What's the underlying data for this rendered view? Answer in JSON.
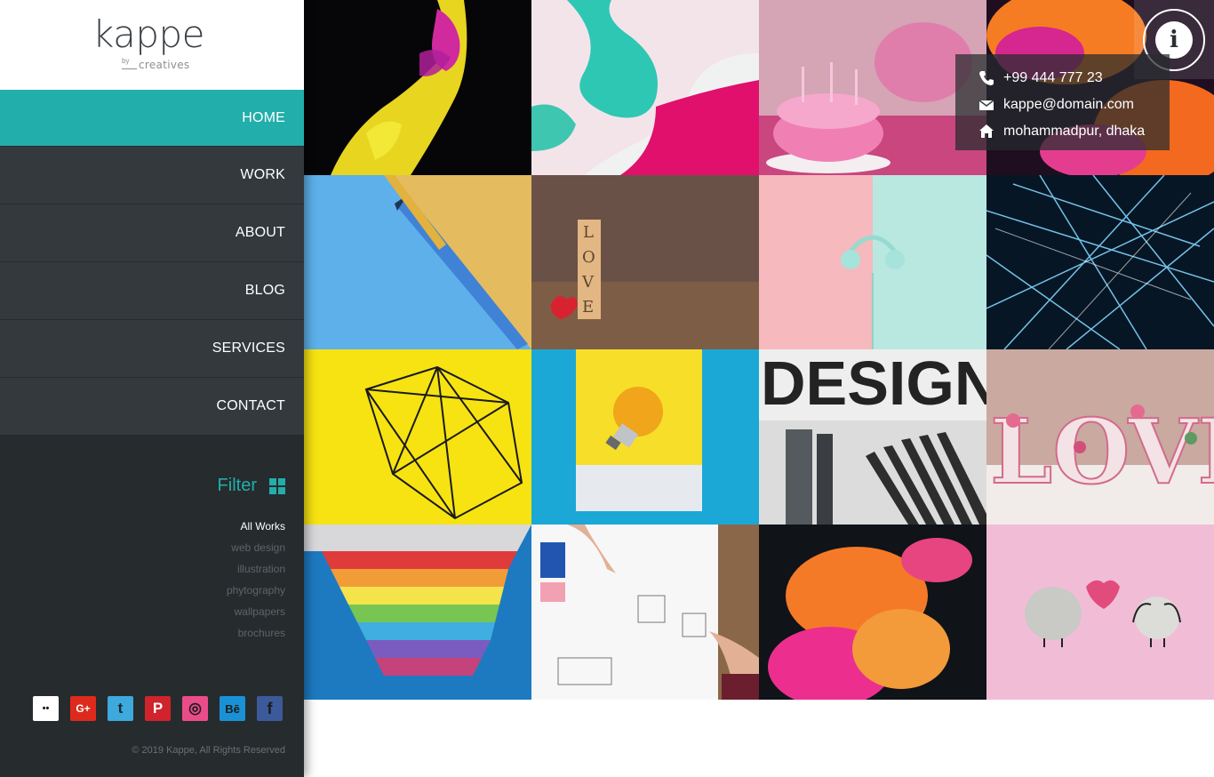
{
  "brand": {
    "name": "kappe",
    "by": "by",
    "tagline": "creatives"
  },
  "nav": [
    {
      "label": "HOME",
      "active": true
    },
    {
      "label": "WORK"
    },
    {
      "label": "ABOUT"
    },
    {
      "label": "BLOG"
    },
    {
      "label": "SERVICES"
    },
    {
      "label": "CONTACT"
    }
  ],
  "filter": {
    "title": "Filter",
    "icon": "grid-icon",
    "items": [
      "All Works",
      "web design",
      "illustration",
      "phytography",
      "wallpapers",
      "brochures"
    ],
    "active": "All Works"
  },
  "social": [
    {
      "name": "flickr-icon",
      "glyph": "••",
      "bg": "#ffffff",
      "fg": "#1c1c1c"
    },
    {
      "name": "google-plus-icon",
      "glyph": "G+",
      "bg": "#dd2a1d",
      "fg": "#ffffff"
    },
    {
      "name": "twitter-icon",
      "glyph": "t",
      "bg": "#3ea9dd",
      "fg": "#1c2a33"
    },
    {
      "name": "pinterest-icon",
      "glyph": "P",
      "bg": "#d0232b",
      "fg": "#ffffff"
    },
    {
      "name": "dribbble-icon",
      "glyph": "◎",
      "bg": "#ea4c89",
      "fg": "#1c1c1c"
    },
    {
      "name": "behance-icon",
      "glyph": "Bē",
      "bg": "#1a91d5",
      "fg": "#1c1c1c"
    },
    {
      "name": "facebook-icon",
      "glyph": "f",
      "bg": "#3c5a99",
      "fg": "#1c1c1c"
    }
  ],
  "copyright": "© 2019 Kappe, All Rights Reserved",
  "contact": {
    "phone": "+99 444 777 23",
    "email": "kappe@domain.com",
    "address": "mohammadpur, dhaka"
  },
  "gallery": [
    "ink-yellow-magenta",
    "marble-teal-pink",
    "pink-cake-flowers",
    "ink-orange-magenta",
    "blue-pencil",
    "love-blocks",
    "mint-headphones",
    "blue-light-lines",
    "wire-geometry-yellow",
    "light-bulb",
    "design-pencils",
    "floral-love-letters",
    "color-swatches",
    "sketching-hands",
    "orange-smoke",
    "stone-love-couple"
  ],
  "design_word": "DESIGN",
  "love_word": "LOVE",
  "colors": {
    "accent": "#22aeab",
    "sidebar": "#262b2e",
    "nav": "#33393d"
  }
}
